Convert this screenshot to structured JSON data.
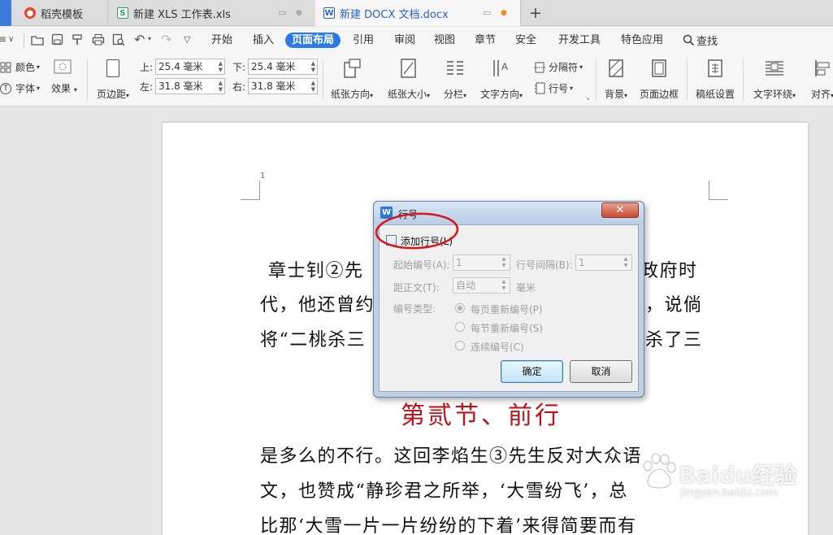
{
  "tabs": [
    {
      "title": "稻壳模板",
      "icon": "daoke-logo-icon"
    },
    {
      "title": "新建 XLS 工作表.xls",
      "icon": "spreadsheet-icon"
    },
    {
      "title": "新建 DOCX 文档.docx",
      "icon": "writer-doc-icon",
      "active": true
    }
  ],
  "menu": {
    "items": [
      "开始",
      "插入",
      "页面布局",
      "引用",
      "审阅",
      "视图",
      "章节",
      "安全",
      "开发工具",
      "特色应用"
    ],
    "active": "页面布局",
    "search_label": "查找"
  },
  "ribbon": {
    "color_label": "颜色",
    "font_label": "字体",
    "effects_label": "效果",
    "margins_label": "页边距",
    "margin_top_label": "上:",
    "margin_top_value": "25.4 毫米",
    "margin_bottom_label": "下:",
    "margin_bottom_value": "25.4 毫米",
    "margin_left_label": "左:",
    "margin_left_value": "31.8 毫米",
    "margin_right_label": "右:",
    "margin_right_value": "31.8 毫米",
    "orientation_label": "纸张方向",
    "size_label": "纸张大小",
    "columns_label": "分栏",
    "text_direction_label": "文字方向",
    "breaks_label": "分隔符",
    "line_numbers_label": "行号",
    "background_label": "背景",
    "page_border_label": "页面边框",
    "manuscript_label": "稿纸设置",
    "text_wrap_label": "文字环绕",
    "align_label": "对齐"
  },
  "document": {
    "page_number": "1",
    "lines": [
      "章士钊②先",
      "政府时",
      "代，他还曾约",
      "，说倘",
      "将“二桃杀三",
      "杀了三",
      "是多么的不行。这回李焰生③先生反对大众语",
      "文，也赞成“静珍君之所举，‘大雪纷飞’，总",
      "比那‘大雪一片一片纷纷的下着’来得简要而有"
    ],
    "section_heading": "第贰节、前行"
  },
  "dialog": {
    "title": "行号",
    "add_line_numbers_label": "添加行号(L)",
    "start_at_label": "起始编号(A):",
    "start_at_value": "1",
    "count_by_label": "行号间隔(B):",
    "count_by_value": "1",
    "from_text_label": "距正文(T):",
    "from_text_value": "自动",
    "unit_label": "毫米",
    "numbering_label": "编号类型:",
    "options": [
      "每页重新编号(P)",
      "每节重新编号(S)",
      "连续编号(C)"
    ],
    "selected_option": "每页重新编号(P)",
    "ok_label": "确定",
    "cancel_label": "取消"
  },
  "watermark": {
    "text": "Baidu经验",
    "url": "jingyan.baidu.com"
  },
  "colors": {
    "accent": "#2c7be5",
    "heading_red": "#c0101a",
    "annotation_circle": "#d9141d"
  }
}
